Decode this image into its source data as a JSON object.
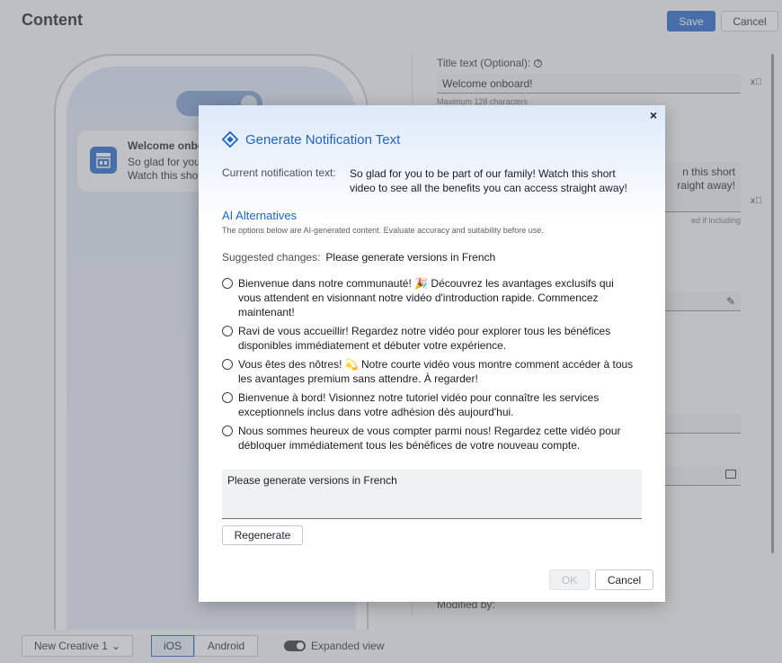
{
  "page": {
    "title": "Content",
    "save_label": "Save",
    "cancel_label": "Cancel"
  },
  "preview": {
    "notification_title": "Welcome onbo",
    "notification_body_line1": "So glad for you",
    "notification_body_line2": "Watch this sho"
  },
  "form": {
    "title_label": "Title text (Optional):",
    "title_value": "Welcome onboard!",
    "title_help": "Maximum 128 characters",
    "body_line1": "n this short",
    "body_line2": "raight away!",
    "body_help": "ed if including",
    "modified_label": "Modified by:"
  },
  "bottom_bar": {
    "creative_select": "New Creative 1",
    "ios_label": "iOS",
    "android_label": "Android",
    "expanded_view_label": "Expanded view"
  },
  "modal": {
    "close_glyph": "×",
    "title": "Generate Notification Text",
    "current_label": "Current notification text:",
    "current_text": "So glad for you to be part of our family! Watch this short video to see all the benefits you can access straight away!",
    "ai_title": "AI Alternatives",
    "ai_disclaimer": "The options below are AI-generated content. Evaluate accuracy and suitability before use.",
    "suggested_label": "Suggested changes:",
    "suggested_value": "Please generate versions in French",
    "options": [
      "Bienvenue dans notre communauté! 🎉 Découvrez les avantages exclusifs qui vous attendent en visionnant notre vidéo d'introduction rapide. Commencez maintenant!",
      "Ravi de vous accueillir! Regardez notre vidéo pour explorer tous les bénéfices disponibles immédiatement et débuter votre expérience.",
      "Vous êtes des nôtres! 💫 Notre courte vidéo vous montre comment accéder à tous les avantages premium sans attendre. À regarder!",
      "Bienvenue à bord! Visionnez notre tutoriel vidéo pour connaître les services exceptionnels inclus dans votre adhésion dès aujourd'hui.",
      "Nous sommes heureux de vous compter parmi nous! Regardez cette vidéo pour débloquer immédiatement tous les bénéfices de votre nouveau compte."
    ],
    "prompt_value": "Please generate versions in French",
    "regenerate_label": "Regenerate",
    "ok_label": "OK",
    "cancel_label": "Cancel"
  },
  "colors": {
    "accent": "#1f65c9",
    "overlay": "rgba(120,122,128,0.45)"
  },
  "icons": [
    "help-icon",
    "translate-icon",
    "pencil-icon",
    "folder-icon",
    "chevron-down-icon",
    "close-icon",
    "ai-logo-icon",
    "store-icon"
  ]
}
